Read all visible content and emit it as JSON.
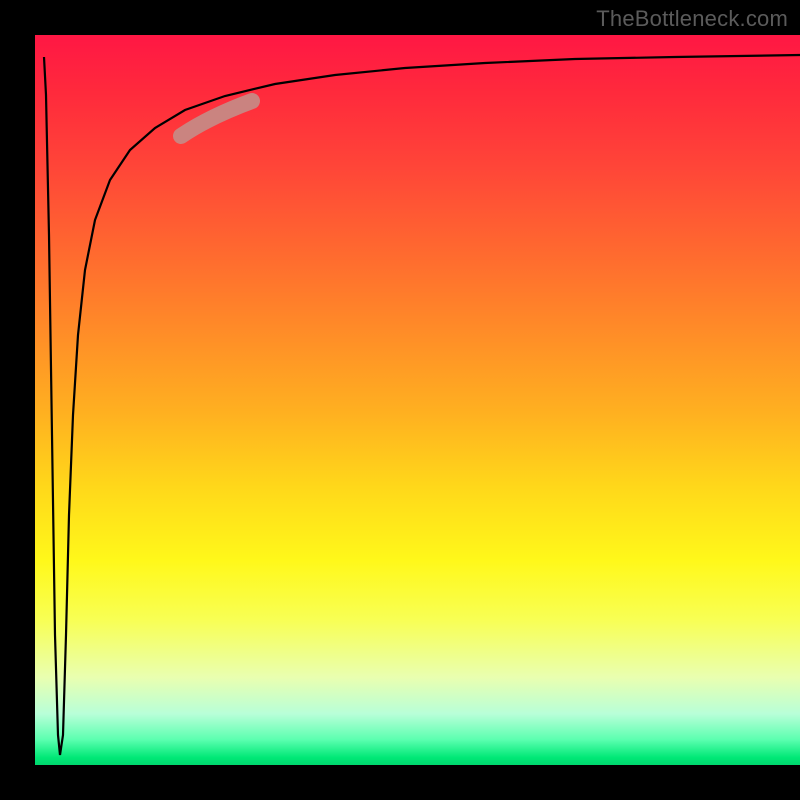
{
  "watermark": "TheBottleneck.com",
  "chart_data": {
    "type": "line",
    "title": "",
    "xlabel": "",
    "ylabel": "",
    "xlim": [
      0,
      100
    ],
    "ylim": [
      0,
      100
    ],
    "grid": false,
    "legend": false,
    "background_gradient": {
      "direction": "vertical",
      "stops": [
        {
          "pos": 0,
          "color": "#ff1744"
        },
        {
          "pos": 50,
          "color": "#ffc000"
        },
        {
          "pos": 80,
          "color": "#f8ff40"
        },
        {
          "pos": 100,
          "color": "#00d66e"
        }
      ]
    },
    "series": [
      {
        "name": "bottleneck-curve",
        "description": "Falls from near top (~y=97) at x≈1 sharply to y≈0 at x≈3, then rises steeply and asymptotically approaches y≈97 as x→100.",
        "x": [
          1,
          2,
          3,
          4,
          5,
          6,
          8,
          10,
          12,
          15,
          20,
          25,
          30,
          40,
          50,
          60,
          70,
          80,
          90,
          100
        ],
        "y": [
          96,
          50,
          2,
          40,
          58,
          67,
          77,
          82,
          85,
          88,
          90.5,
          92,
          93,
          94.5,
          95.3,
          95.8,
          96.2,
          96.5,
          96.7,
          96.9
        ]
      }
    ],
    "highlight_segment": {
      "series": "bottleneck-curve",
      "x_range": [
        20,
        30
      ],
      "color": "#c58b87"
    }
  }
}
